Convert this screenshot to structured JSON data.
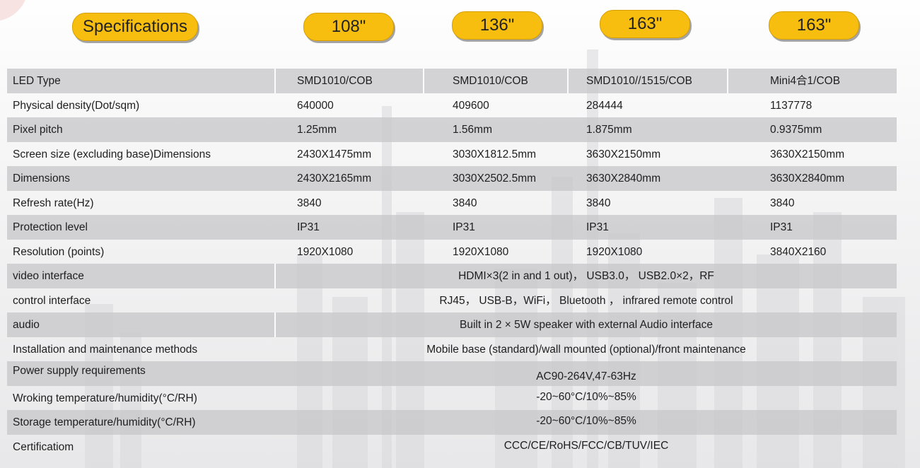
{
  "header": {
    "spec_label": "Specifications",
    "columns": [
      "108\"",
      "136\"",
      "163\"",
      "163\""
    ]
  },
  "rows": [
    {
      "label": "LED Type",
      "values": [
        "SMD1010/COB",
        "SMD1010/COB",
        "SMD1010//1515/COB",
        "Mini4合1/COB"
      ]
    },
    {
      "label": "Physical density(Dot/sqm)",
      "values": [
        "640000",
        "409600",
        "284444",
        "1137778"
      ]
    },
    {
      "label": "Pixel pitch",
      "values": [
        "1.25mm",
        "1.56mm",
        "1.875mm",
        "0.9375mm"
      ]
    },
    {
      "label": "Screen size (excluding base)Dimensions",
      "values": [
        "2430X1475mm",
        "3030X1812.5mm",
        "3630X2150mm",
        "3630X2150mm"
      ]
    },
    {
      "label": "Dimensions",
      "values": [
        "2430X2165mm",
        "3030X2502.5mm",
        "3630X2840mm",
        "3630X2840mm"
      ]
    },
    {
      "label": "Refresh rate(Hz)",
      "values": [
        "3840",
        "3840",
        "3840",
        "3840"
      ]
    },
    {
      "label": "Protection level",
      "values": [
        "IP31",
        "IP31",
        "IP31",
        "IP31"
      ]
    },
    {
      "label": "Resolution (points)",
      "values": [
        "1920X1080",
        "1920X1080",
        "1920X1080",
        "3840X2160"
      ]
    },
    {
      "label": "video interface",
      "span": "HDMI×3(2 in and 1 out)， USB3.0， USB2.0×2，RF"
    },
    {
      "label": "control interface",
      "span": "RJ45， USB-B，WiFi， Bluetooth ， infrared remote control"
    },
    {
      "label": "audio",
      "span": "Built in 2 × 5W speaker with external Audio interface"
    },
    {
      "label": "Installation and maintenance methods",
      "span": "Mobile base (standard)/wall mounted (optional)/front maintenance"
    },
    {
      "label": "Power supply requirements",
      "span": "AC90-264V,47-63Hz"
    },
    {
      "label": "Wroking temperature/humidity(°C/RH)",
      "span": "-20~60°C/10%~85%"
    },
    {
      "label": "Storage  temperature/humidity(°C/RH)",
      "span": "-20~60°C/10%~85%"
    },
    {
      "label": "Certificatiom",
      "span": "CCC/CE/RoHS/FCC/CB/TUV/IEC"
    }
  ],
  "colors": {
    "pill": "#f7be10",
    "row_shade": "#c8c8ca"
  }
}
